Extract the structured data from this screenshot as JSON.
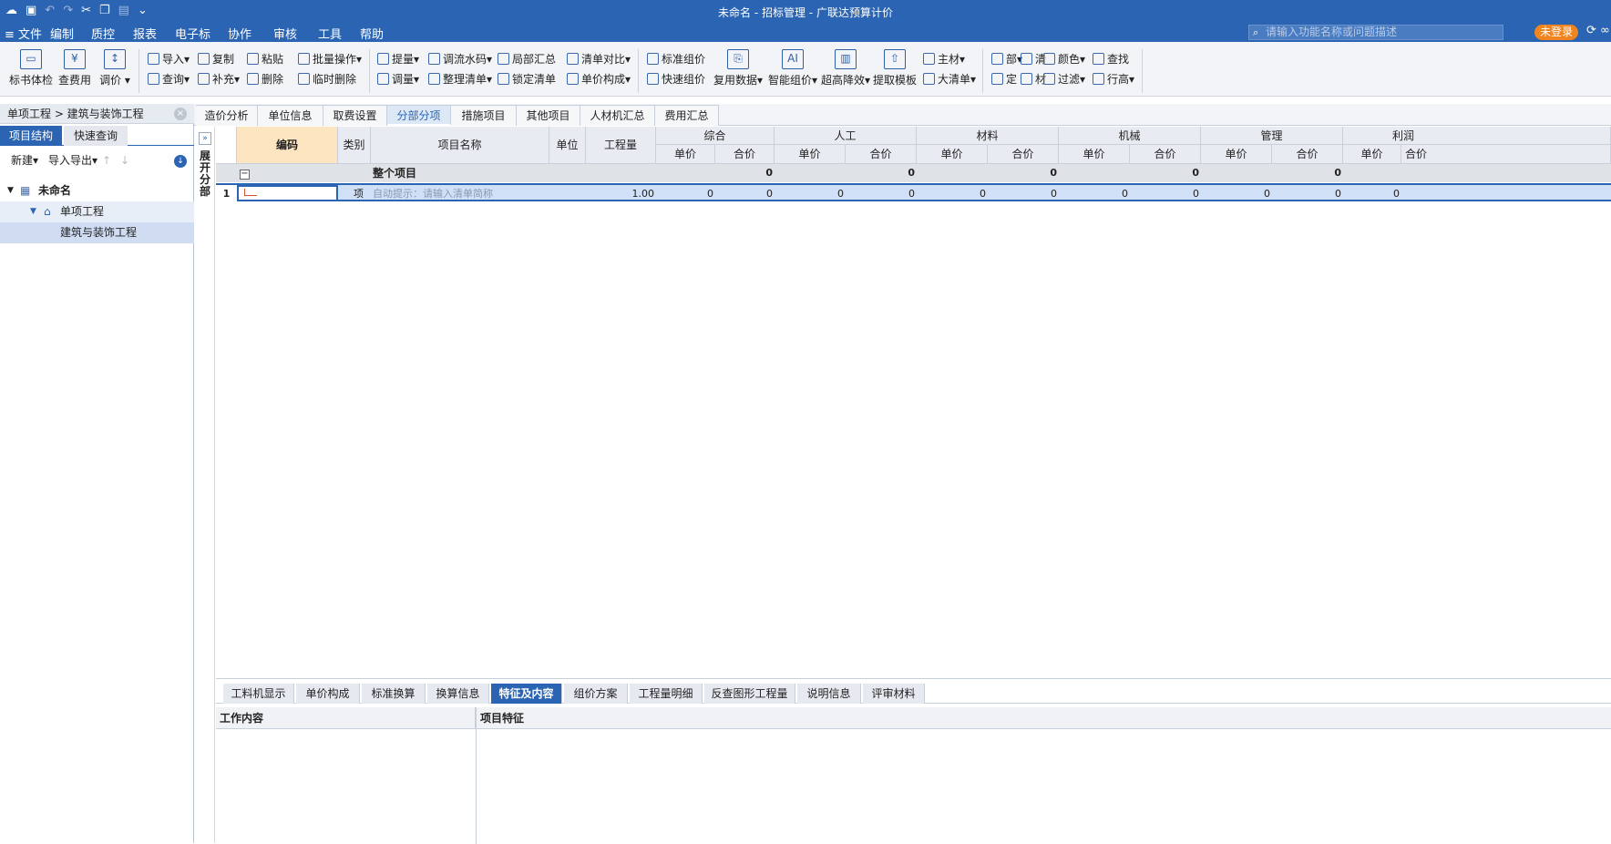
{
  "window": {
    "title": "未命名 - 招标管理 - 广联达预算计价"
  },
  "menu": {
    "items": [
      "文件",
      "编制",
      "质控",
      "报表",
      "电子标",
      "协作",
      "审核",
      "工具",
      "帮助"
    ],
    "active": "编制"
  },
  "search": {
    "placeholder": "请输入功能名称或问题描述"
  },
  "login": {
    "label": "未登录"
  },
  "ribbon": {
    "big": [
      "标书体检",
      "查费用",
      "调价",
      "复用数据",
      "智能组价",
      "超高降效",
      "提取模板"
    ],
    "small": {
      "import": "导入",
      "query": "查询",
      "copy": "复制",
      "supplement": "补充",
      "paste": "粘贴",
      "delete": "删除",
      "batch": "批量操作",
      "temp_delete": "临时删除",
      "lift": "提量",
      "adjust": "调量",
      "water_code": "调流水码",
      "tidy": "整理清单",
      "partial": "局部汇总",
      "lock": "锁定清单",
      "compare": "清单对比",
      "unit_comp": "单价构成",
      "std_price": "标准组价",
      "quick_price": "快速组价",
      "main_mat": "主材",
      "big_list": "大清单",
      "bu": "部",
      "ding": "定",
      "qing": "清",
      "cai": "材",
      "color": "颜色",
      "find": "查找",
      "filter": "过滤",
      "row_height": "行高"
    }
  },
  "left": {
    "breadcrumb": "单项工程 > 建筑与装饰工程",
    "tabs": [
      "项目结构",
      "快速查询"
    ],
    "new_label": "新建",
    "import_export": "导入导出",
    "tree": {
      "root": "未命名",
      "child": "单项工程",
      "leaf": "建筑与装饰工程"
    }
  },
  "top_tabs": [
    "造价分析",
    "单位信息",
    "取费设置",
    "分部分项",
    "措施项目",
    "其他项目",
    "人材机汇总",
    "费用汇总"
  ],
  "active_top_tab": "分部分项",
  "expander": {
    "btn": "»",
    "text": "展开分部"
  },
  "grid": {
    "headers": {
      "code": "编码",
      "type": "类别",
      "name": "项目名称",
      "unit": "单位",
      "qty": "工程量"
    },
    "groups": [
      "综合",
      "人工",
      "材料",
      "机械",
      "管理",
      "利润"
    ],
    "sub": {
      "unit_price": "单价",
      "total": "合价"
    },
    "summary_row": {
      "label": "整个项目",
      "values": [
        "0",
        "0",
        "0",
        "0",
        "0"
      ]
    },
    "row1": {
      "num": "1",
      "type": "项",
      "hint": "自动提示：请输入清单简称",
      "qty": "1.00",
      "values": [
        "0",
        "0",
        "0",
        "0",
        "0",
        "0",
        "0",
        "0",
        "0",
        "0",
        "0"
      ]
    }
  },
  "bottom": {
    "tabs": [
      "工料机显示",
      "单价构成",
      "标准换算",
      "换算信息",
      "特征及内容",
      "组价方案",
      "工程量明细",
      "反查图形工程量",
      "说明信息",
      "评审材料"
    ],
    "active": "特征及内容",
    "work_content": "工作内容",
    "features": "项目特征"
  }
}
